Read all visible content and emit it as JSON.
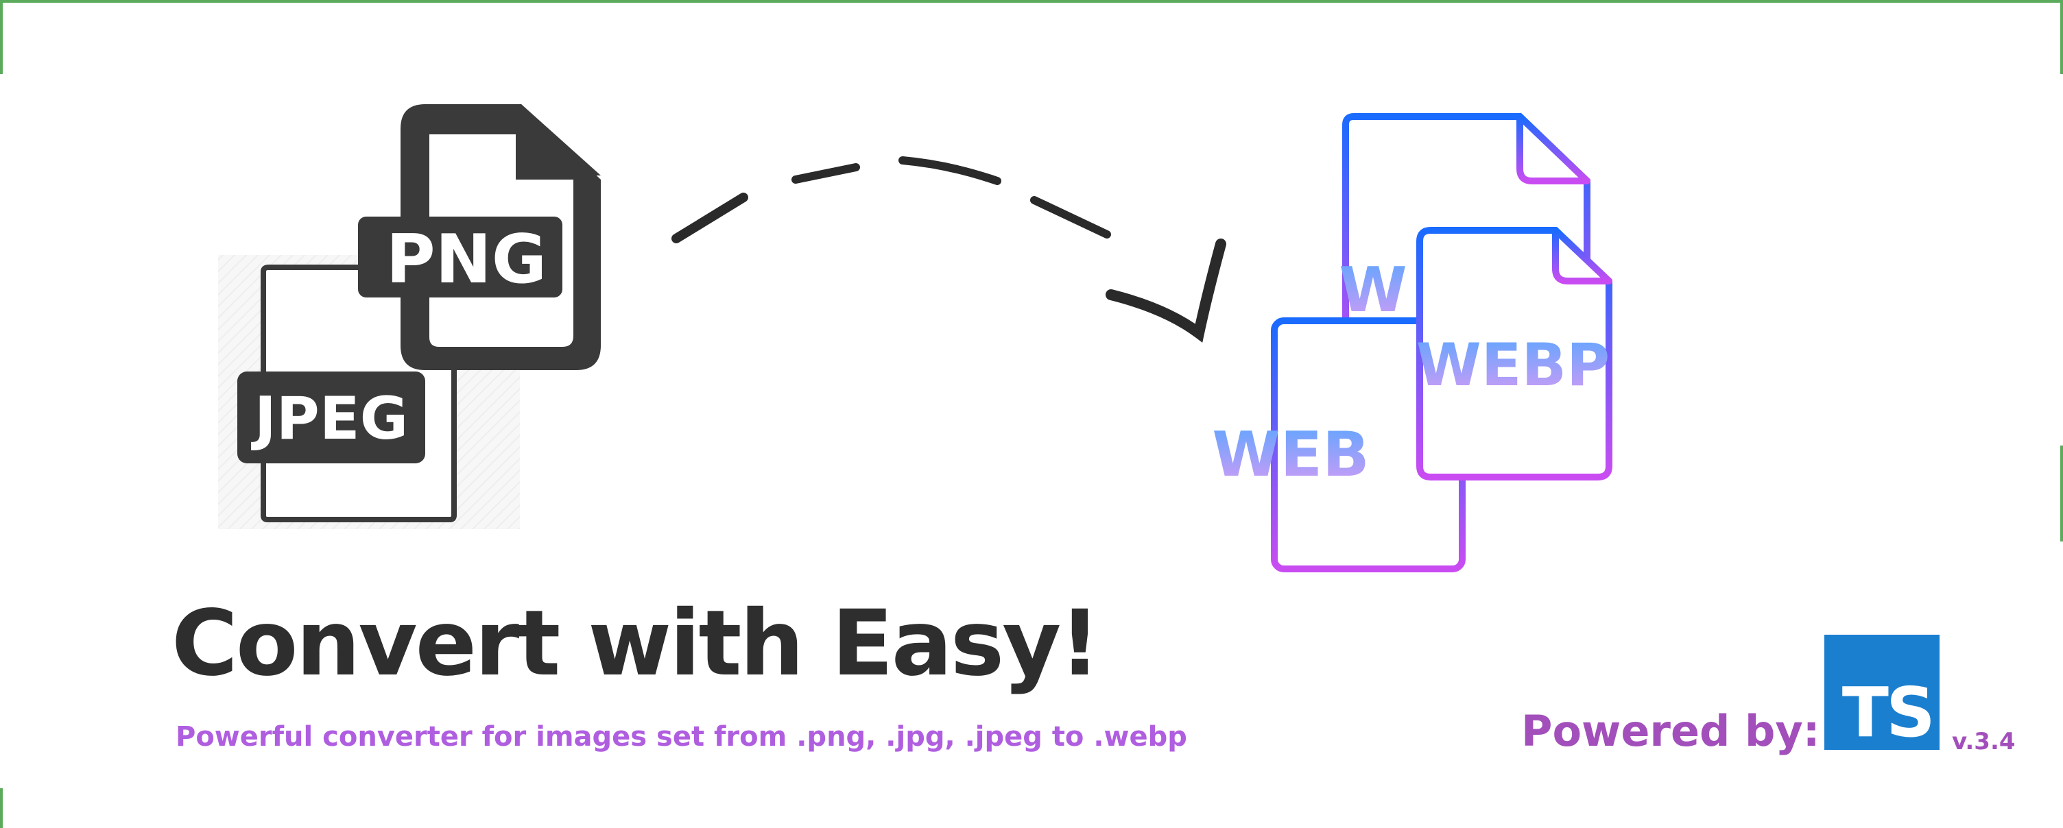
{
  "icons": {
    "png_label": "PNG",
    "jpeg_label": "JPEG",
    "webp_front_label": "WEBP",
    "webp_back_label": "W",
    "webp_left_label": "WEB"
  },
  "headline": "Convert with Easy!",
  "subline": "Powerful converter for images set from .png, .jpg, .jpeg to .webp",
  "powered_by": "Powered by:",
  "ts_logo_text": "TS",
  "version": "v.3.4",
  "colors": {
    "dark": "#2e2e2e",
    "purple": "#a24fbb",
    "subline": "#b05ee0",
    "ts_blue": "#1b7fd0",
    "webp_gradient_top": "#1a6bff",
    "webp_gradient_bottom": "#c94cf2",
    "frame_green": "#5cab5c"
  }
}
